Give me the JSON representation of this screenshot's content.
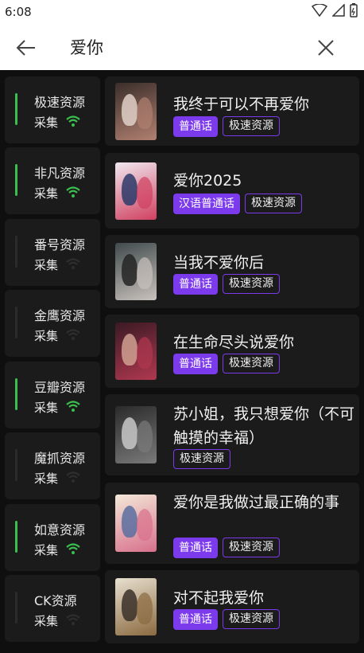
{
  "status_bar": {
    "time": "6:08"
  },
  "app_bar": {
    "title": "爱你"
  },
  "sources": [
    {
      "name": "极速资源",
      "sub": "采集",
      "active": true
    },
    {
      "name": "非凡资源",
      "sub": "采集",
      "active": true
    },
    {
      "name": "番号资源",
      "sub": "采集",
      "active": false
    },
    {
      "name": "金鹰资源",
      "sub": "采集",
      "active": false
    },
    {
      "name": "豆瓣资源",
      "sub": "采集",
      "active": true
    },
    {
      "name": "魔抓资源",
      "sub": "采集",
      "active": false
    },
    {
      "name": "如意资源",
      "sub": "采集",
      "active": true
    },
    {
      "name": "CK资源",
      "sub": "采集",
      "active": false
    }
  ],
  "results": [
    {
      "title": "我终于可以不再爱你",
      "tags": [
        "普通话",
        "极速资源"
      ]
    },
    {
      "title": "爱你2025",
      "tags": [
        "汉语普通话",
        "极速资源"
      ]
    },
    {
      "title": "当我不爱你后",
      "tags": [
        "普通话",
        "极速资源"
      ]
    },
    {
      "title": "在生命尽头说爱你",
      "tags": [
        "普通话",
        "极速资源"
      ]
    },
    {
      "title": "苏小姐，我只想爱你（不可触摸的幸福）",
      "tags": [
        "极速资源"
      ]
    },
    {
      "title": "爱你是我做过最正确的事",
      "tags": [
        "普通话",
        "极速资源"
      ]
    },
    {
      "title": "对不起我爱你",
      "tags": [
        "普通话",
        "极速资源"
      ]
    }
  ],
  "colors": {
    "accent": "#7c3aed",
    "active": "#3bbf4e",
    "panel": "#1b1b1b"
  }
}
